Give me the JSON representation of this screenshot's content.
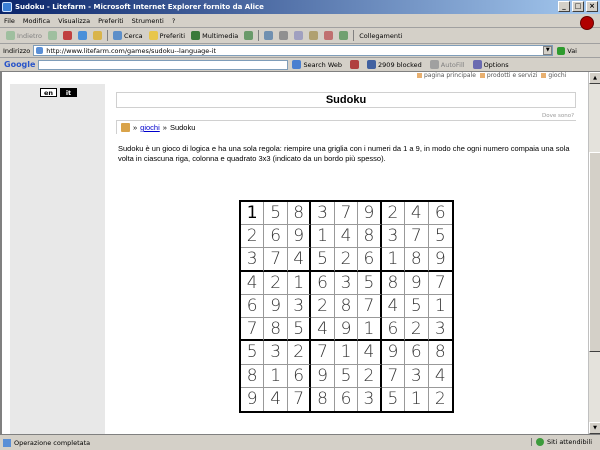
{
  "window": {
    "title": "Sudoku - Litefarm - Microsoft Internet Explorer fornito da Alice"
  },
  "menu": [
    "File",
    "Modifica",
    "Visualizza",
    "Preferiti",
    "Strumenti",
    "?"
  ],
  "toolbar": {
    "back": "Indietro",
    "search": "Cerca",
    "favorites": "Preferiti",
    "multimedia": "Multimedia",
    "links": "Collegamenti"
  },
  "address": {
    "label": "Indirizzo",
    "url": "http://www.litefarm.com/games/sudoku--language-it",
    "go": "Vai"
  },
  "google_bar": {
    "logo": "Google",
    "search_web": "Search Web",
    "blocked": "2909 blocked",
    "autofill": "AutoFill",
    "options": "Options"
  },
  "page": {
    "lang_en": "en",
    "lang_it": "it",
    "topnav": [
      "pagina principale",
      "prodotti e servizi",
      "giochi"
    ],
    "title": "Sudoku",
    "where": "Dove sono?",
    "breadcrumb": {
      "sep1": "»",
      "link": "giochi",
      "sep2": "»",
      "current": "Sudoku"
    },
    "description": "Sudoku è un gioco di logica e ha una sola regola: riempire una griglia con i numeri da 1 a 9, in modo che ogni numero compaia una sola volta in ciascuna riga, colonna e quadrato 3x3 (indicato da un bordo più spesso)."
  },
  "sudoku": [
    [
      "1",
      "5",
      "8",
      "3",
      "7",
      "9",
      "2",
      "4",
      "6"
    ],
    [
      "2",
      "6",
      "9",
      "1",
      "4",
      "8",
      "3",
      "7",
      "5"
    ],
    [
      "3",
      "7",
      "4",
      "5",
      "2",
      "6",
      "1",
      "8",
      "9"
    ],
    [
      "4",
      "2",
      "1",
      "6",
      "3",
      "5",
      "8",
      "9",
      "7"
    ],
    [
      "6",
      "9",
      "3",
      "2",
      "8",
      "7",
      "4",
      "5",
      "1"
    ],
    [
      "7",
      "8",
      "5",
      "4",
      "9",
      "1",
      "6",
      "2",
      "3"
    ],
    [
      "5",
      "3",
      "2",
      "7",
      "1",
      "4",
      "9",
      "6",
      "8"
    ],
    [
      "8",
      "1",
      "6",
      "9",
      "5",
      "2",
      "7",
      "3",
      "4"
    ],
    [
      "9",
      "4",
      "7",
      "8",
      "6",
      "3",
      "5",
      "1",
      "2"
    ]
  ],
  "status": {
    "left": "Operazione completata",
    "right": "Siti attendibili"
  }
}
